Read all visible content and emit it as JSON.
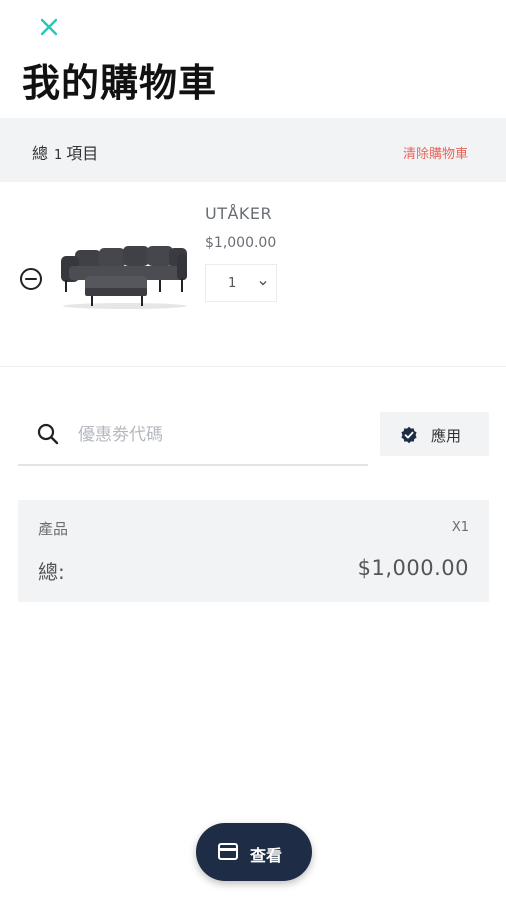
{
  "header": {
    "close_icon": "close-icon",
    "title": "我的購物車"
  },
  "summary": {
    "total_label": "總",
    "item_count": "1",
    "items_label": "項目",
    "clear_label": "清除購物車"
  },
  "cart": {
    "items": [
      {
        "name": "UTÅKER",
        "price": "$1,000.00",
        "quantity": "1",
        "remove_icon": "minus-circle-icon",
        "image": "sofa-image"
      }
    ]
  },
  "coupon": {
    "placeholder": "優惠劵代碼",
    "value": "",
    "apply_label": "應用",
    "search_icon": "search-icon",
    "apply_icon": "verified-badge-icon"
  },
  "totals": {
    "products_label": "產品",
    "products_count": "X1",
    "total_label": "總:",
    "total_value": "$1,000.00"
  },
  "checkout": {
    "label": "查看",
    "icon": "credit-card-icon"
  },
  "colors": {
    "accent": "#2ec4b6",
    "clear_text": "#e8655c",
    "primary_button": "#1e2d45",
    "panel_bg": "#f2f3f4"
  }
}
